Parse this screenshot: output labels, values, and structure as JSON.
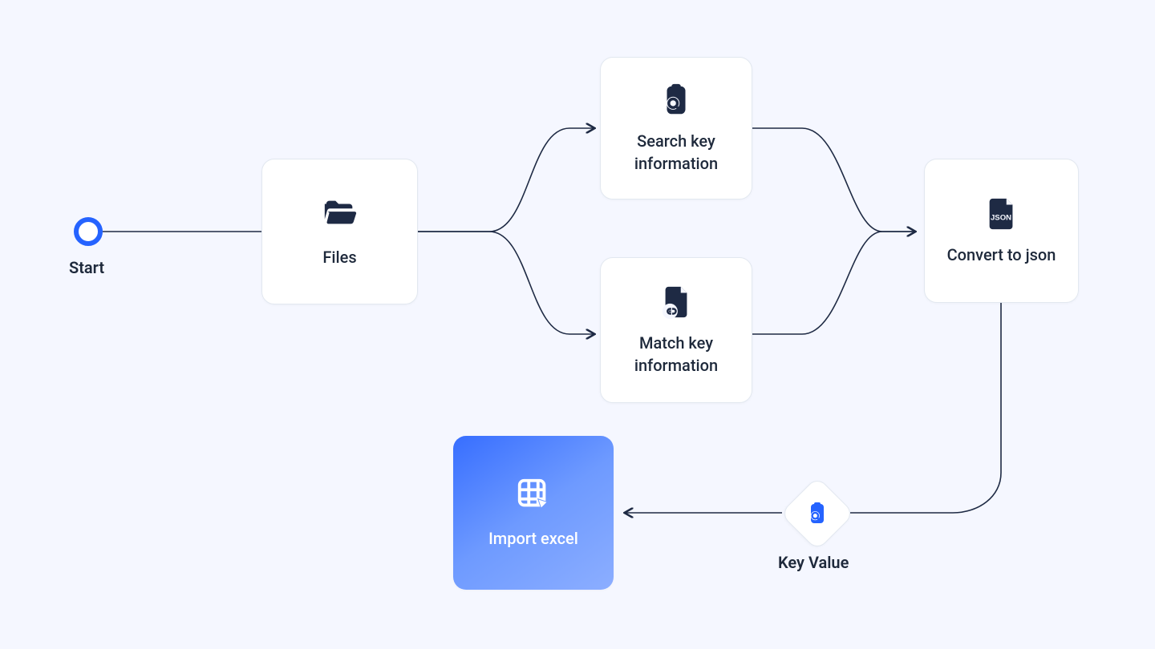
{
  "start": {
    "label": "Start"
  },
  "nodes": {
    "files": {
      "label": "Files"
    },
    "search": {
      "label": "Search key information"
    },
    "match": {
      "label": "Match key information"
    },
    "convert": {
      "label": "Convert to json"
    },
    "import": {
      "label": "Import excel"
    }
  },
  "decision": {
    "keyvalue": {
      "label": "Key Value"
    }
  },
  "icons": {
    "files": "folder-open-icon",
    "search": "clipboard-search-icon",
    "match": "file-link-icon",
    "convert": "file-json-icon",
    "import": "grid-edit-icon",
    "keyvalue": "clipboard-search-icon-accent"
  },
  "colors": {
    "ink": "#1e2a44",
    "accent": "#2563ff",
    "edge": "#1e2a44",
    "panel": "#ffffff",
    "bg": "#f5f7ff"
  }
}
